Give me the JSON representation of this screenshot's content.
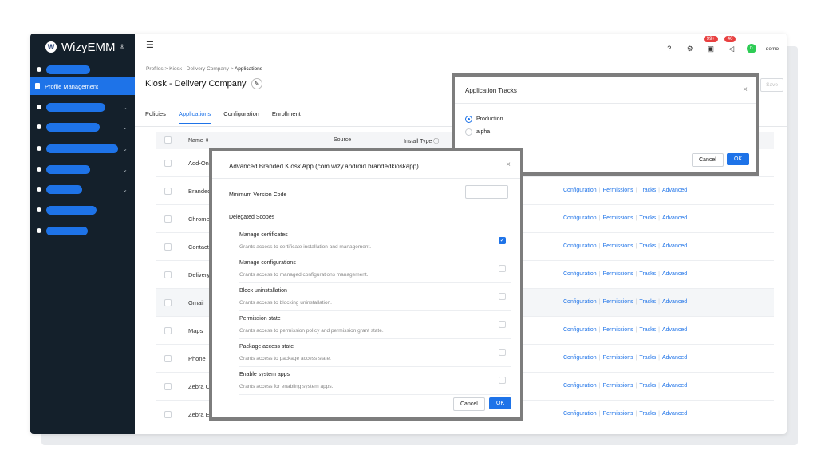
{
  "app": {
    "logo_text": "WizyEMM",
    "logo_mark": "W",
    "logo_sup": "®"
  },
  "sidebar": {
    "active_item": "Profile Management"
  },
  "topbar": {
    "notif_badge_1": "99+",
    "notif_badge_2": "40",
    "avatar_initials": "D",
    "user": "demo"
  },
  "breadcrumb": {
    "item1": "Profiles",
    "sep": ">",
    "item2": "Kiosk - Delivery Company",
    "item3": "Applications"
  },
  "page": {
    "title": "Kiosk - Delivery Company",
    "save_label": "Save"
  },
  "tabs": [
    "Policies",
    "Applications",
    "Configuration",
    "Enrollment"
  ],
  "table": {
    "headers": {
      "name": "Name",
      "source": "Source",
      "install_type": "Install Type"
    },
    "rows": [
      "Add-On",
      "Branded K",
      "Chrome",
      "Contacts",
      "Delivery",
      "Gmail",
      "Maps",
      "Phone",
      "Zebra Co",
      "Zebra En"
    ],
    "link_labels": [
      "Configuration",
      "Permissions",
      "Tracks",
      "Advanced"
    ],
    "sep": "|"
  },
  "tracks_modal": {
    "title": "Application Tracks",
    "close": "×",
    "options": [
      {
        "label": "Production",
        "selected": true
      },
      {
        "label": "alpha",
        "selected": false
      }
    ],
    "cancel": "Cancel",
    "ok": "OK"
  },
  "advanced_modal": {
    "title": "Advanced Branded Kiosk App (com.wizy.android.brandedkioskapp)",
    "close": "×",
    "min_version_label": "Minimum Version Code",
    "min_version_value": "",
    "delegated_scopes_label": "Delegated Scopes",
    "scopes": [
      {
        "title": "Manage certificates",
        "desc": "Grants access to certificate installation and management.",
        "checked": true
      },
      {
        "title": "Manage configurations",
        "desc": "Grants access to managed configurations management.",
        "checked": false
      },
      {
        "title": "Block uninstallation",
        "desc": "Grants access to blocking uninstallation.",
        "checked": false
      },
      {
        "title": "Permission state",
        "desc": "Grants access to permission policy and permission grant state.",
        "checked": false
      },
      {
        "title": "Package access state",
        "desc": "Grants access to package access state.",
        "checked": false
      },
      {
        "title": "Enable system apps",
        "desc": "Grants access for enabling system apps.",
        "checked": false
      }
    ],
    "cancel": "Cancel",
    "ok": "OK"
  },
  "colors": {
    "accent": "#1e73e8",
    "sidebar_bg": "#14202b",
    "badge": "#e84040"
  }
}
